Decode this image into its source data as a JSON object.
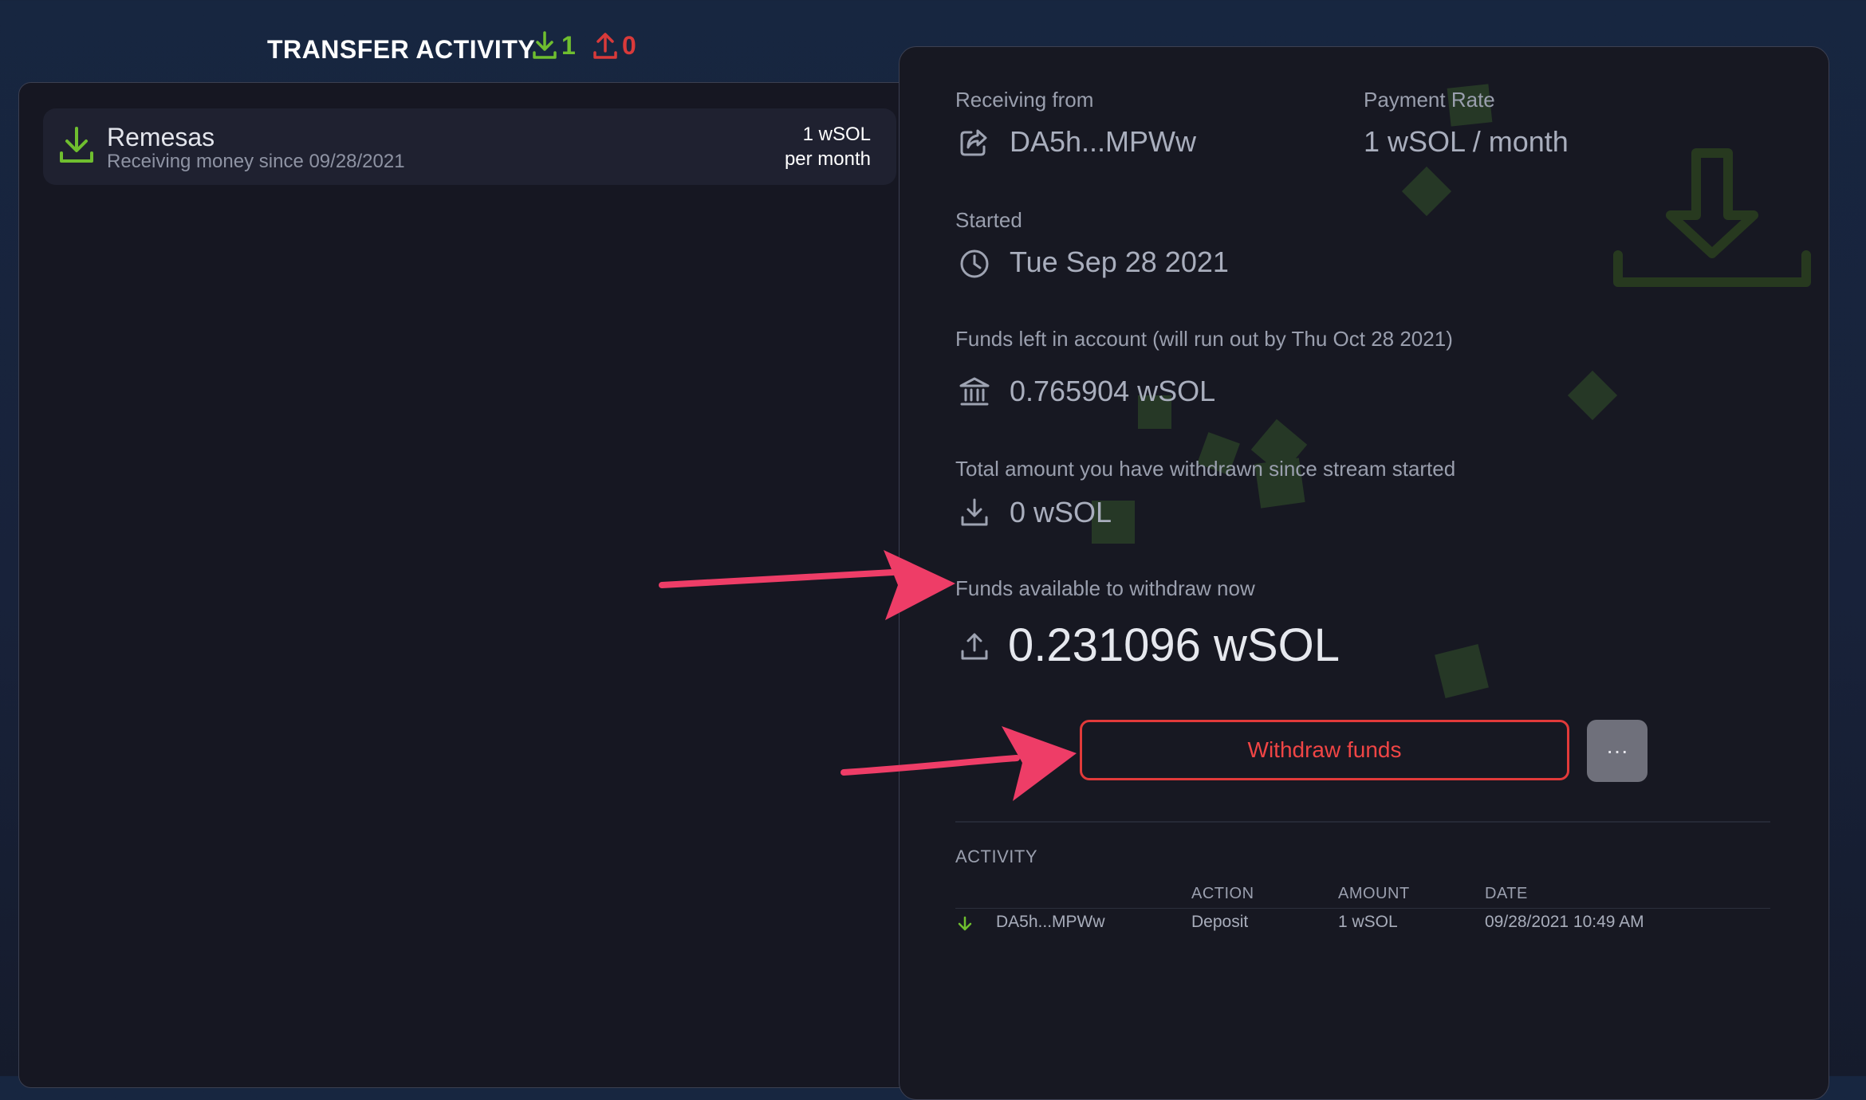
{
  "header": {
    "title": "TRANSFER ACTIVITY",
    "incoming_count": "1",
    "outgoing_count": "0"
  },
  "streams": [
    {
      "name": "Remesas",
      "subtitle": "Receiving money since 09/28/2021",
      "rate_amount": "1 wSOL",
      "rate_period": "per month"
    }
  ],
  "details": {
    "receiving_from_label": "Receiving from",
    "receiving_from_value": "DA5h...MPWw",
    "payment_rate_label": "Payment Rate",
    "payment_rate_value": "1 wSOL / month",
    "started_label": "Started",
    "started_value": "Tue Sep 28 2021",
    "funds_left_label": "Funds left in account (will run out by Thu Oct 28 2021)",
    "funds_left_value": "0.765904 wSOL",
    "withdrawn_label": "Total amount you have withdrawn since stream started",
    "withdrawn_value": "0 wSOL",
    "available_label": "Funds available to withdraw now",
    "available_value": "0.231096 wSOL"
  },
  "actions": {
    "withdraw_label": "Withdraw funds",
    "more_label": "···"
  },
  "activity": {
    "title": "ACTIVITY",
    "columns": [
      "ACTION",
      "AMOUNT",
      "DATE"
    ],
    "rows": [
      {
        "from": "DA5h...MPWw",
        "action": "Deposit",
        "amount": "1 wSOL",
        "date": "09/28/2021 10:49 AM"
      }
    ]
  },
  "colors": {
    "incoming": "#6fbe2f",
    "outgoing": "#d93a3a",
    "annotation_arrow": "#ee3d67",
    "withdraw_border": "#e23a3a"
  }
}
